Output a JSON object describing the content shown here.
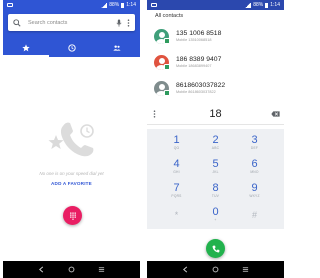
{
  "left_phone": {
    "status": {
      "battery": "88%",
      "time": "1:14"
    },
    "search": {
      "placeholder": "Search contacts"
    },
    "tabs": [
      {
        "icon": "star-icon",
        "active": true
      },
      {
        "icon": "clock-icon",
        "active": false
      },
      {
        "icon": "contacts-icon",
        "active": false
      }
    ],
    "favorites": {
      "empty_text": "No one is on your speed dial yet",
      "add_favorite_label": "ADD A FAVORITE"
    },
    "fab_icon": "dialpad-icon"
  },
  "right_phone": {
    "status": {
      "battery": "88%",
      "time": "1:14"
    },
    "contacts_header": "All contacts",
    "contacts": [
      {
        "number": "135 1006 8518",
        "sub": "Mobile 13510068518",
        "color": "#3f9f7a"
      },
      {
        "number": "186 8389 9407",
        "sub": "Mobile 18683899407",
        "color": "#e0533f"
      },
      {
        "number": "8618603037822",
        "sub": "Mobile 8618603037822",
        "color": "#7f8c8d"
      }
    ],
    "dial": {
      "number": "18"
    },
    "keypad": [
      {
        "digit": "1",
        "letters": "QΩ"
      },
      {
        "digit": "2",
        "letters": "ABC"
      },
      {
        "digit": "3",
        "letters": "DEF"
      },
      {
        "digit": "4",
        "letters": "GHI"
      },
      {
        "digit": "5",
        "letters": "JKL"
      },
      {
        "digit": "6",
        "letters": "MNO"
      },
      {
        "digit": "7",
        "letters": "PQRS"
      },
      {
        "digit": "8",
        "letters": "TUV"
      },
      {
        "digit": "9",
        "letters": "WXYZ"
      },
      {
        "symbol": "*"
      },
      {
        "digit": "0",
        "letters": "+"
      },
      {
        "symbol": "#"
      }
    ]
  },
  "colors": {
    "primary_blue": "#2f55d4",
    "status_blue_dark": "#2b48ae",
    "fab_pink": "#e91e63",
    "call_green": "#21b24d"
  }
}
